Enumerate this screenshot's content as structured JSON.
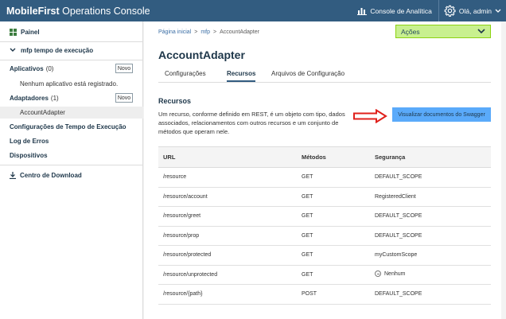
{
  "header": {
    "brand_bold": "MobileFirst",
    "brand_rest": " Operations Console",
    "analytics_label": "Console de Analítica",
    "user_label": "Olá, admin"
  },
  "sidebar": {
    "dashboard": "Painel",
    "runtime": "mfp tempo de execução",
    "applications": {
      "label": "Aplicativos",
      "count": "(0)",
      "new": "Novo"
    },
    "no_apps": "Nenhum aplicativo está registrado.",
    "adapters": {
      "label": "Adaptadores",
      "count": "(1)",
      "new": "Novo"
    },
    "adapter_item": "AccountAdapter",
    "runtime_settings": "Configurações de Tempo de Execução",
    "error_log": "Log de Erros",
    "devices": "Dispositivos",
    "download_center": "Centro de Download"
  },
  "main": {
    "breadcrumb": {
      "home": "Página inicial",
      "sep1": ">",
      "runtime": "mfp",
      "sep2": ">",
      "current": "AccountAdapter"
    },
    "actions_label": "Ações",
    "title": "AccountAdapter",
    "tabs": [
      {
        "label": "Configurações"
      },
      {
        "label": "Recursos"
      },
      {
        "label": "Arquivos de Configuração"
      }
    ],
    "section_title": "Recursos",
    "section_desc": "Um recurso, conforme definido em REST, é um objeto com tipo, dados associados, relacionamentos com outros recursos e um conjunto de métodos que operam nele.",
    "swagger_button": "Visualizar documentos do Swagger",
    "table": {
      "headers": {
        "url": "URL",
        "methods": "Métodos",
        "security": "Segurança"
      },
      "rows": [
        {
          "url": "/resource",
          "method": "GET",
          "security": "DEFAULT_SCOPE"
        },
        {
          "url": "/resource/account",
          "method": "GET",
          "security": "RegisteredClient"
        },
        {
          "url": "/resource/greet",
          "method": "GET",
          "security": "DEFAULT_SCOPE"
        },
        {
          "url": "/resource/prop",
          "method": "GET",
          "security": "DEFAULT_SCOPE"
        },
        {
          "url": "/resource/protected",
          "method": "GET",
          "security": "myCustomScope"
        },
        {
          "url": "/resource/unprotected",
          "method": "GET",
          "security": "Nenhum"
        },
        {
          "url": "/resource/{path}",
          "method": "POST",
          "security": "DEFAULT_SCOPE"
        }
      ]
    }
  },
  "colors": {
    "header_bg": "#325c80",
    "actions_bg": "#c8f08f",
    "swagger_bg": "#5aaafa",
    "annotation_arrow": "#e0201b"
  }
}
